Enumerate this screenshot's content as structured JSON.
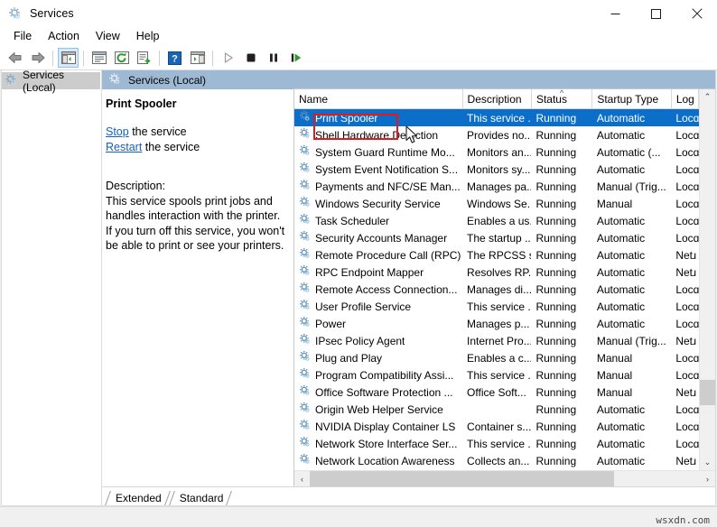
{
  "window": {
    "title": "Services",
    "title_icon": "services-gear-icon",
    "minimize_label": "Minimize",
    "maximize_label": "Maximize",
    "close_label": "Close"
  },
  "menubar": {
    "items": [
      {
        "label": "File",
        "name": "menu-file"
      },
      {
        "label": "Action",
        "name": "menu-action"
      },
      {
        "label": "View",
        "name": "menu-view"
      },
      {
        "label": "Help",
        "name": "menu-help"
      }
    ]
  },
  "toolbar": {
    "buttons": [
      {
        "name": "back-icon",
        "glyph": "back-arrow",
        "pressed": false
      },
      {
        "name": "forward-icon",
        "glyph": "forward-arrow",
        "pressed": false
      },
      {
        "name": "show-hide-console-tree-icon",
        "glyph": "tree-pane",
        "pressed": true
      },
      {
        "name": "properties-icon",
        "glyph": "properties",
        "pressed": false
      },
      {
        "name": "refresh-icon",
        "glyph": "refresh",
        "pressed": false
      },
      {
        "name": "export-list-icon",
        "glyph": "export-list",
        "pressed": false
      },
      {
        "name": "help-icon",
        "glyph": "help-question",
        "pressed": false
      },
      {
        "name": "show-action-pane-icon",
        "glyph": "action-pane",
        "pressed": false
      },
      {
        "name": "start-service-icon",
        "glyph": "play",
        "pressed": false
      },
      {
        "name": "stop-service-icon",
        "glyph": "stop",
        "pressed": false
      },
      {
        "name": "pause-service-icon",
        "glyph": "pause",
        "pressed": false
      },
      {
        "name": "restart-service-icon",
        "glyph": "restart",
        "pressed": false
      }
    ]
  },
  "tree": {
    "root_label": "Services (Local)",
    "root_icon": "services-gear-icon"
  },
  "pane": {
    "header_label": "Services (Local)",
    "header_icon": "services-gear-icon"
  },
  "details": {
    "service_name": "Print Spooler",
    "stop_link": "Stop",
    "stop_suffix": " the service",
    "restart_link": "Restart",
    "restart_suffix": " the service",
    "description_label": "Description:",
    "description_text": "This service spools print jobs and handles interaction with the printer. If you turn off this service, you won't be able to print or see your printers."
  },
  "list": {
    "columns": [
      {
        "label": "Name",
        "name": "column-header-name",
        "sorted": false
      },
      {
        "label": "Description",
        "name": "column-header-description",
        "sorted": false
      },
      {
        "label": "Status",
        "name": "column-header-status",
        "sorted": true,
        "sort_glyph": "^"
      },
      {
        "label": "Startup Type",
        "name": "column-header-startup-type",
        "sorted": false
      },
      {
        "label": "Log",
        "name": "column-header-log-on-as",
        "sorted": false
      }
    ],
    "rows": [
      {
        "name": "Print Spooler",
        "description": "This service ...",
        "status": "Running",
        "startup": "Automatic",
        "logon": "Locɑ",
        "selected": true
      },
      {
        "name": "Shell Hardware Detection",
        "description": "Provides no...",
        "status": "Running",
        "startup": "Automatic",
        "logon": "Locɑ",
        "selected": false
      },
      {
        "name": "System Guard Runtime Mo...",
        "description": "Monitors an...",
        "status": "Running",
        "startup": "Automatic (...",
        "logon": "Locɑ",
        "selected": false
      },
      {
        "name": "System Event Notification S...",
        "description": "Monitors sy...",
        "status": "Running",
        "startup": "Automatic",
        "logon": "Locɑ",
        "selected": false
      },
      {
        "name": "Payments and NFC/SE Man...",
        "description": "Manages pa...",
        "status": "Running",
        "startup": "Manual (Trig...",
        "logon": "Locɑ",
        "selected": false
      },
      {
        "name": "Windows Security Service",
        "description": "Windows Se...",
        "status": "Running",
        "startup": "Manual",
        "logon": "Locɑ",
        "selected": false
      },
      {
        "name": "Task Scheduler",
        "description": "Enables a us...",
        "status": "Running",
        "startup": "Automatic",
        "logon": "Locɑ",
        "selected": false
      },
      {
        "name": "Security Accounts Manager",
        "description": "The startup ...",
        "status": "Running",
        "startup": "Automatic",
        "logon": "Locɑ",
        "selected": false
      },
      {
        "name": "Remote Procedure Call (RPC)",
        "description": "The RPCSS s...",
        "status": "Running",
        "startup": "Automatic",
        "logon": "Netɹ",
        "selected": false
      },
      {
        "name": "RPC Endpoint Mapper",
        "description": "Resolves RP...",
        "status": "Running",
        "startup": "Automatic",
        "logon": "Netɹ",
        "selected": false
      },
      {
        "name": "Remote Access Connection...",
        "description": "Manages di...",
        "status": "Running",
        "startup": "Automatic",
        "logon": "Locɑ",
        "selected": false
      },
      {
        "name": "User Profile Service",
        "description": "This service ...",
        "status": "Running",
        "startup": "Automatic",
        "logon": "Locɑ",
        "selected": false
      },
      {
        "name": "Power",
        "description": "Manages p...",
        "status": "Running",
        "startup": "Automatic",
        "logon": "Locɑ",
        "selected": false
      },
      {
        "name": "IPsec Policy Agent",
        "description": "Internet Pro...",
        "status": "Running",
        "startup": "Manual (Trig...",
        "logon": "Netɹ",
        "selected": false
      },
      {
        "name": "Plug and Play",
        "description": "Enables a c...",
        "status": "Running",
        "startup": "Manual",
        "logon": "Locɑ",
        "selected": false
      },
      {
        "name": "Program Compatibility Assi...",
        "description": "This service ...",
        "status": "Running",
        "startup": "Manual",
        "logon": "Locɑ",
        "selected": false
      },
      {
        "name": "Office Software Protection ...",
        "description": "Office Soft...",
        "status": "Running",
        "startup": "Manual",
        "logon": "Netɹ",
        "selected": false
      },
      {
        "name": "Origin Web Helper Service",
        "description": "",
        "status": "Running",
        "startup": "Automatic",
        "logon": "Locɑ",
        "selected": false
      },
      {
        "name": "NVIDIA Display Container LS",
        "description": "Container s...",
        "status": "Running",
        "startup": "Automatic",
        "logon": "Locɑ",
        "selected": false
      },
      {
        "name": "Network Store Interface Ser...",
        "description": "This service ...",
        "status": "Running",
        "startup": "Automatic",
        "logon": "Locɑ",
        "selected": false
      },
      {
        "name": "Network Location Awareness",
        "description": "Collects an...",
        "status": "Running",
        "startup": "Automatic",
        "logon": "Netɹ",
        "selected": false
      }
    ],
    "row_icon": "service-gear-icon"
  },
  "scrollbars": {
    "vertical_up_glyph": "⌃",
    "vertical_down_glyph": "⌄",
    "horizontal_left_glyph": "‹",
    "horizontal_right_glyph": "›"
  },
  "tabs": [
    {
      "label": "Extended",
      "name": "tab-extended",
      "active": false
    },
    {
      "label": "Standard",
      "name": "tab-standard",
      "active": true
    }
  ],
  "statusbar": {
    "watermark": "wsxdn.com"
  },
  "annotation": {
    "highlight_color": "#e01b1b",
    "highlight_target": "Print Spooler"
  },
  "colors": {
    "selection_blue": "#0b6fc9",
    "pane_header_blue": "#9db9d3",
    "link_blue": "#1560bd",
    "window_bg": "#f0f0f0"
  }
}
